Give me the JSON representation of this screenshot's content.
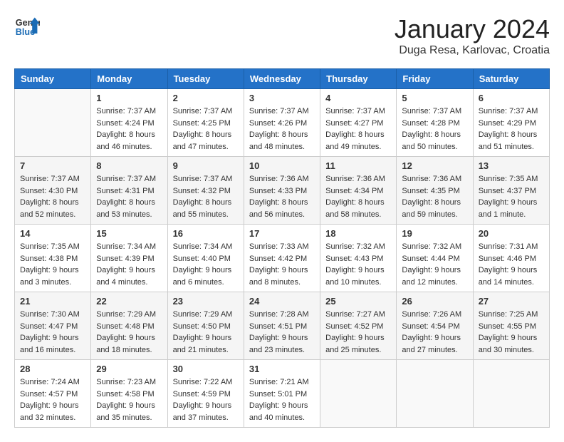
{
  "header": {
    "logo_general": "General",
    "logo_blue": "Blue",
    "month_title": "January 2024",
    "location": "Duga Resa, Karlovac, Croatia"
  },
  "days_of_week": [
    "Sunday",
    "Monday",
    "Tuesday",
    "Wednesday",
    "Thursday",
    "Friday",
    "Saturday"
  ],
  "weeks": [
    [
      {
        "day": "",
        "info": ""
      },
      {
        "day": "1",
        "info": "Sunrise: 7:37 AM\nSunset: 4:24 PM\nDaylight: 8 hours\nand 46 minutes."
      },
      {
        "day": "2",
        "info": "Sunrise: 7:37 AM\nSunset: 4:25 PM\nDaylight: 8 hours\nand 47 minutes."
      },
      {
        "day": "3",
        "info": "Sunrise: 7:37 AM\nSunset: 4:26 PM\nDaylight: 8 hours\nand 48 minutes."
      },
      {
        "day": "4",
        "info": "Sunrise: 7:37 AM\nSunset: 4:27 PM\nDaylight: 8 hours\nand 49 minutes."
      },
      {
        "day": "5",
        "info": "Sunrise: 7:37 AM\nSunset: 4:28 PM\nDaylight: 8 hours\nand 50 minutes."
      },
      {
        "day": "6",
        "info": "Sunrise: 7:37 AM\nSunset: 4:29 PM\nDaylight: 8 hours\nand 51 minutes."
      }
    ],
    [
      {
        "day": "7",
        "info": "Sunrise: 7:37 AM\nSunset: 4:30 PM\nDaylight: 8 hours\nand 52 minutes."
      },
      {
        "day": "8",
        "info": "Sunrise: 7:37 AM\nSunset: 4:31 PM\nDaylight: 8 hours\nand 53 minutes."
      },
      {
        "day": "9",
        "info": "Sunrise: 7:37 AM\nSunset: 4:32 PM\nDaylight: 8 hours\nand 55 minutes."
      },
      {
        "day": "10",
        "info": "Sunrise: 7:36 AM\nSunset: 4:33 PM\nDaylight: 8 hours\nand 56 minutes."
      },
      {
        "day": "11",
        "info": "Sunrise: 7:36 AM\nSunset: 4:34 PM\nDaylight: 8 hours\nand 58 minutes."
      },
      {
        "day": "12",
        "info": "Sunrise: 7:36 AM\nSunset: 4:35 PM\nDaylight: 8 hours\nand 59 minutes."
      },
      {
        "day": "13",
        "info": "Sunrise: 7:35 AM\nSunset: 4:37 PM\nDaylight: 9 hours\nand 1 minute."
      }
    ],
    [
      {
        "day": "14",
        "info": "Sunrise: 7:35 AM\nSunset: 4:38 PM\nDaylight: 9 hours\nand 3 minutes."
      },
      {
        "day": "15",
        "info": "Sunrise: 7:34 AM\nSunset: 4:39 PM\nDaylight: 9 hours\nand 4 minutes."
      },
      {
        "day": "16",
        "info": "Sunrise: 7:34 AM\nSunset: 4:40 PM\nDaylight: 9 hours\nand 6 minutes."
      },
      {
        "day": "17",
        "info": "Sunrise: 7:33 AM\nSunset: 4:42 PM\nDaylight: 9 hours\nand 8 minutes."
      },
      {
        "day": "18",
        "info": "Sunrise: 7:32 AM\nSunset: 4:43 PM\nDaylight: 9 hours\nand 10 minutes."
      },
      {
        "day": "19",
        "info": "Sunrise: 7:32 AM\nSunset: 4:44 PM\nDaylight: 9 hours\nand 12 minutes."
      },
      {
        "day": "20",
        "info": "Sunrise: 7:31 AM\nSunset: 4:46 PM\nDaylight: 9 hours\nand 14 minutes."
      }
    ],
    [
      {
        "day": "21",
        "info": "Sunrise: 7:30 AM\nSunset: 4:47 PM\nDaylight: 9 hours\nand 16 minutes."
      },
      {
        "day": "22",
        "info": "Sunrise: 7:29 AM\nSunset: 4:48 PM\nDaylight: 9 hours\nand 18 minutes."
      },
      {
        "day": "23",
        "info": "Sunrise: 7:29 AM\nSunset: 4:50 PM\nDaylight: 9 hours\nand 21 minutes."
      },
      {
        "day": "24",
        "info": "Sunrise: 7:28 AM\nSunset: 4:51 PM\nDaylight: 9 hours\nand 23 minutes."
      },
      {
        "day": "25",
        "info": "Sunrise: 7:27 AM\nSunset: 4:52 PM\nDaylight: 9 hours\nand 25 minutes."
      },
      {
        "day": "26",
        "info": "Sunrise: 7:26 AM\nSunset: 4:54 PM\nDaylight: 9 hours\nand 27 minutes."
      },
      {
        "day": "27",
        "info": "Sunrise: 7:25 AM\nSunset: 4:55 PM\nDaylight: 9 hours\nand 30 minutes."
      }
    ],
    [
      {
        "day": "28",
        "info": "Sunrise: 7:24 AM\nSunset: 4:57 PM\nDaylight: 9 hours\nand 32 minutes."
      },
      {
        "day": "29",
        "info": "Sunrise: 7:23 AM\nSunset: 4:58 PM\nDaylight: 9 hours\nand 35 minutes."
      },
      {
        "day": "30",
        "info": "Sunrise: 7:22 AM\nSunset: 4:59 PM\nDaylight: 9 hours\nand 37 minutes."
      },
      {
        "day": "31",
        "info": "Sunrise: 7:21 AM\nSunset: 5:01 PM\nDaylight: 9 hours\nand 40 minutes."
      },
      {
        "day": "",
        "info": ""
      },
      {
        "day": "",
        "info": ""
      },
      {
        "day": "",
        "info": ""
      }
    ]
  ]
}
